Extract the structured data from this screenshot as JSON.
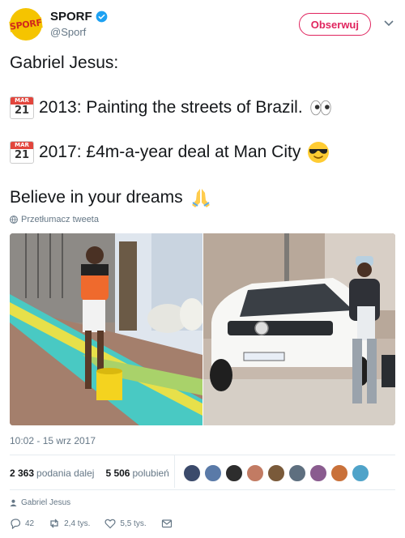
{
  "author": {
    "display_name": "SPORF",
    "handle": "@Sporf",
    "avatar_text": "SPORF"
  },
  "follow_button": {
    "label": "Obserwuj"
  },
  "tweet": {
    "line1": "Gabriel Jesus:",
    "calendar_month": "MAR",
    "calendar_day": "21",
    "line2": "2013: Painting the streets of Brazil.",
    "line3": "2017: £4m-a-year deal at Man City",
    "line4": "Believe in your dreams",
    "icons": [
      "calendar-icon",
      "eyes-emoji",
      "sunglasses-emoji",
      "praying-hands-emoji"
    ]
  },
  "translate": {
    "label": "Przetłumacz tweeta"
  },
  "timestamp": "10:02 - 15 wrz 2017",
  "stats": {
    "retweets_count": "2 363",
    "retweets_label": "podania dalej",
    "likes_count": "5 506",
    "likes_label": "polubień"
  },
  "likers": [
    "#3b4a6b",
    "#5a7aa8",
    "#2d2d2d",
    "#c27b63",
    "#7a5a3a",
    "#5e6f7f",
    "#8a5c8f",
    "#c9713a",
    "#4fa3c9"
  ],
  "context": {
    "label": "Gabriel Jesus"
  },
  "actions": {
    "reply_count": "42",
    "retweet_count": "2,4 tys.",
    "like_count": "5,5 tys."
  },
  "colors": {
    "accent": "#e0245e",
    "verified": "#1da1f2",
    "muted": "#657786"
  }
}
